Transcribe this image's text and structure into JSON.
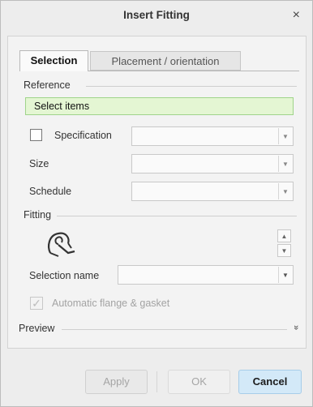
{
  "window": {
    "title": "Insert Fitting",
    "close_glyph": "×"
  },
  "tabs": [
    {
      "label": "Selection",
      "selected": true
    },
    {
      "label": "Placement / orientation",
      "selected": false
    }
  ],
  "reference": {
    "section_label": "Reference",
    "collector_text": "Select items",
    "collector_color": "#e4f6d3"
  },
  "fields": {
    "specification": {
      "label": "Specification",
      "checked": false,
      "value": ""
    },
    "size": {
      "label": "Size",
      "value": ""
    },
    "schedule": {
      "label": "Schedule",
      "value": ""
    }
  },
  "fitting": {
    "section_label": "Fitting",
    "icon": "fitting-elbow-icon",
    "selection_name_label": "Selection name",
    "selection_name_value": "",
    "auto_flange_label": "Automatic flange & gasket",
    "auto_flange_checked": true
  },
  "preview": {
    "label": "Preview",
    "expand_glyph": "»"
  },
  "buttons": {
    "apply": "Apply",
    "ok": "OK",
    "cancel": "Cancel"
  },
  "colors": {
    "cancel_accent": "#d3e9f8",
    "reference_border": "#9fd48a"
  }
}
